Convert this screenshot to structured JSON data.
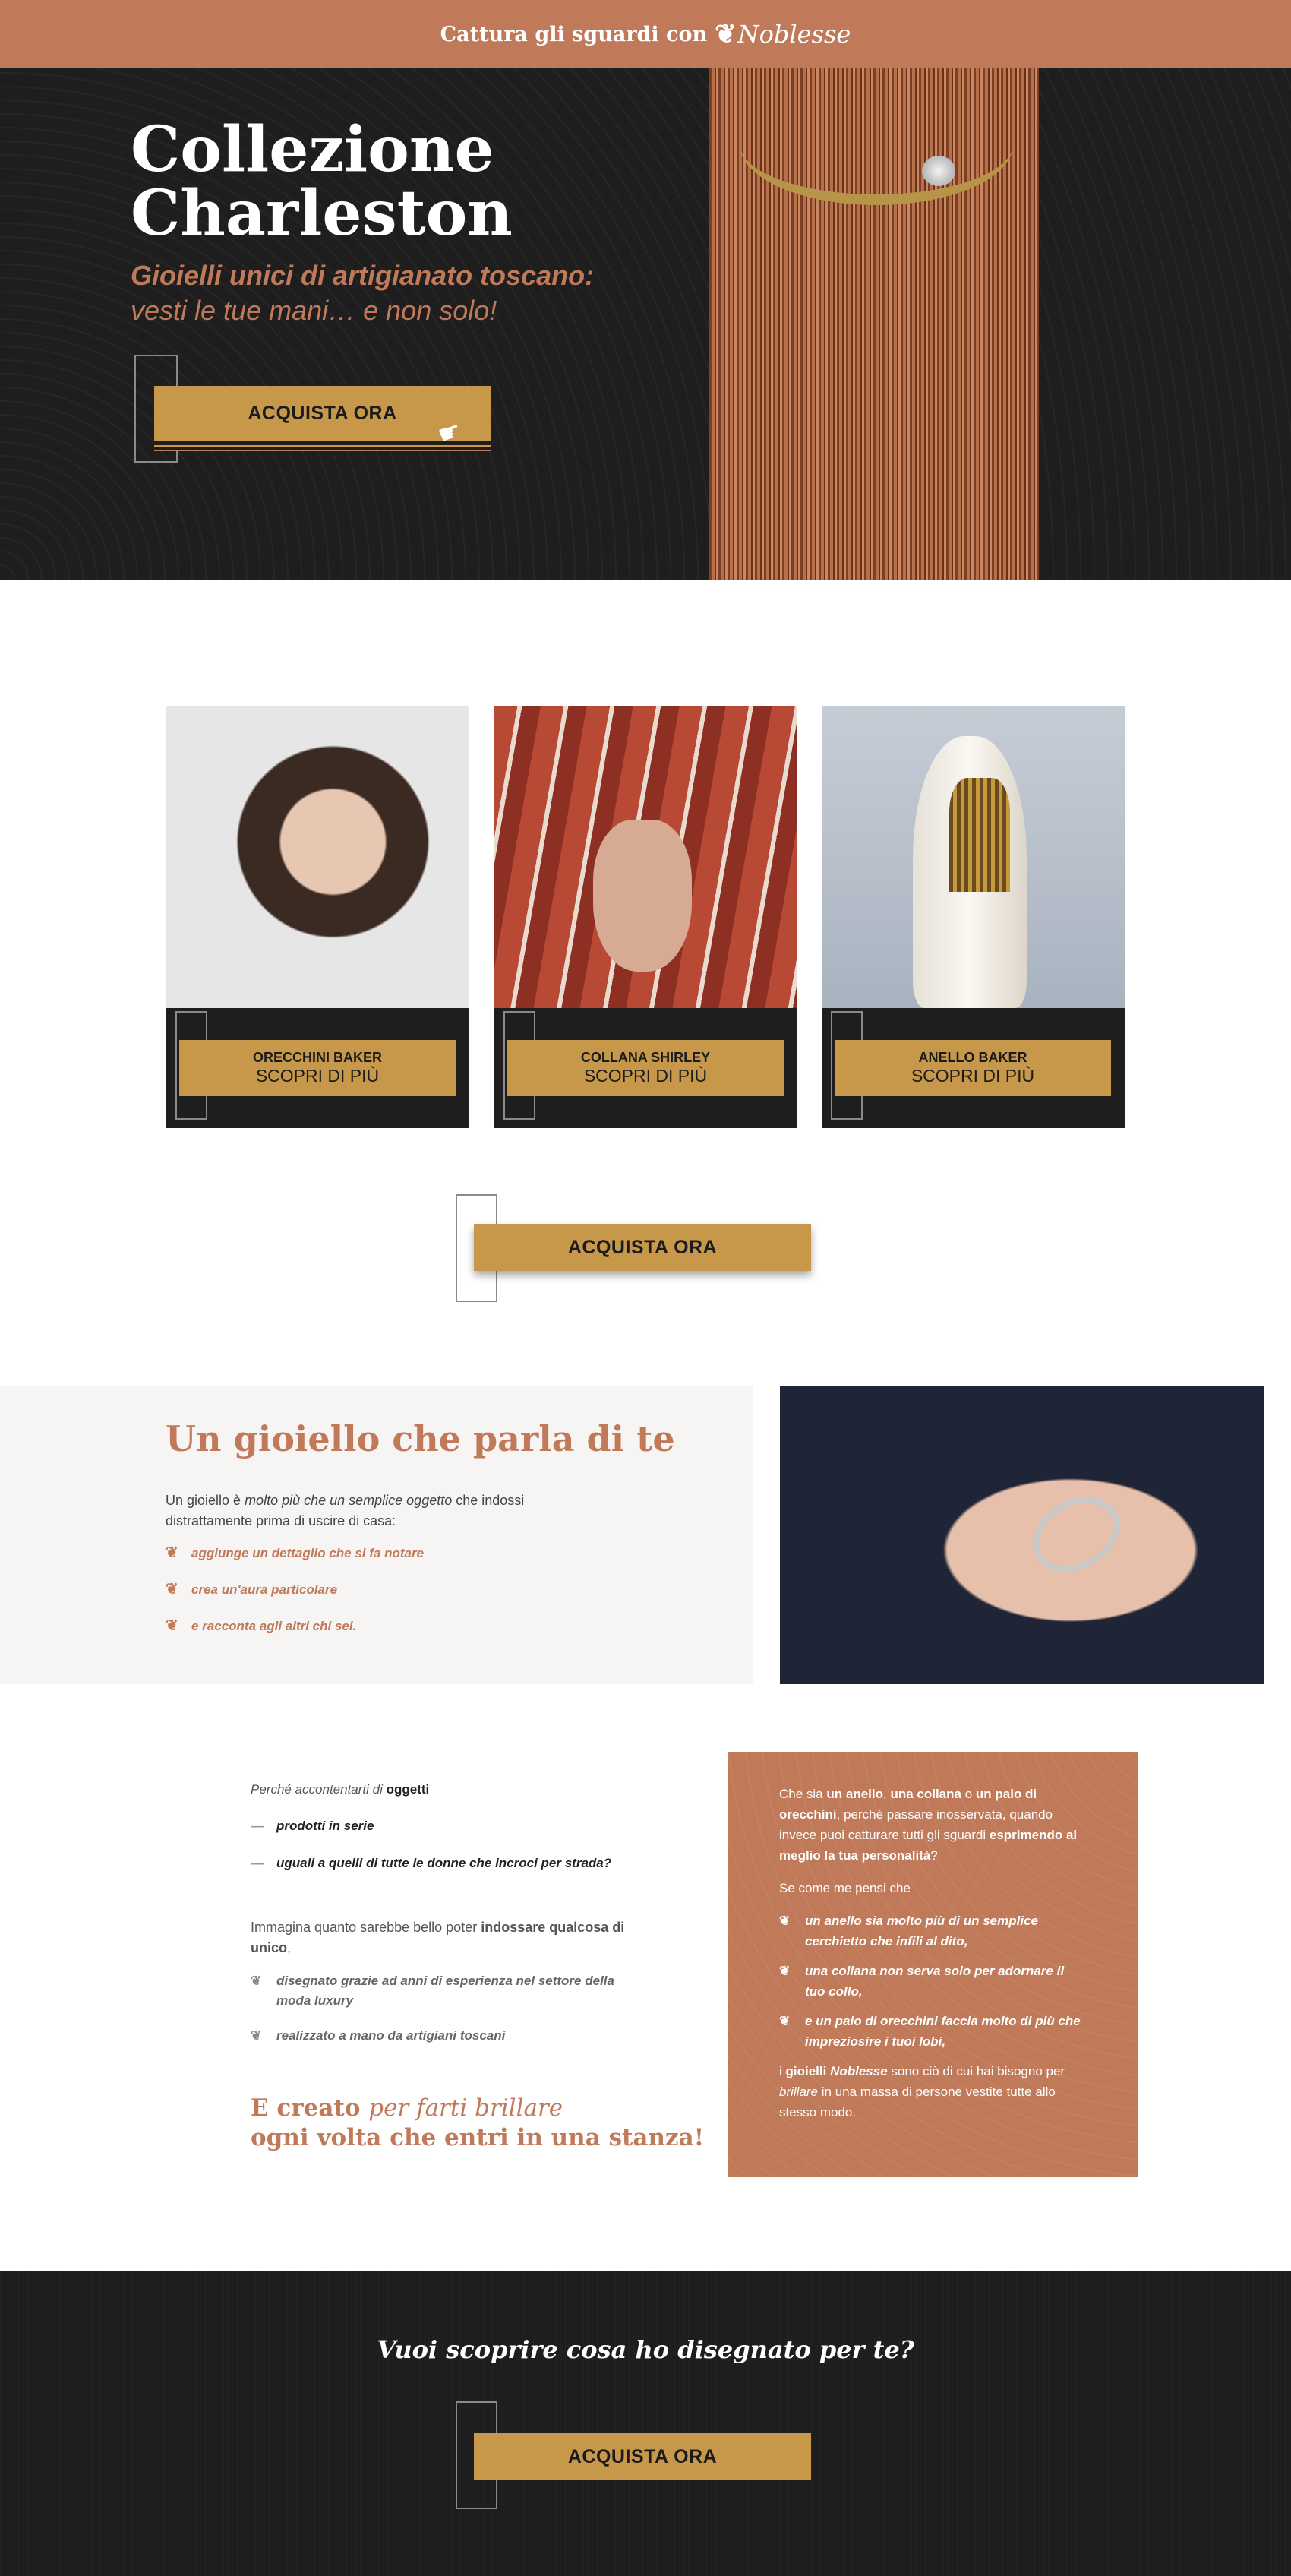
{
  "topbar": {
    "text": "Cattura gli sguardi con",
    "brand": "Noblesse",
    "brand_icon": "flower-icon"
  },
  "hero": {
    "title": "Collezione Charleston",
    "subtitle_bold": "Gioielli unici di artigianato toscano:",
    "subtitle_regular": "vesti le tue mani… e non solo!",
    "cta": "ACQUISTA ORA"
  },
  "products": [
    {
      "name": "ORECCHINI BAKER",
      "cta": "SCOPRI DI PIÙ"
    },
    {
      "name": "COLLANA SHIRLEY",
      "cta": "SCOPRI DI PIÙ"
    },
    {
      "name": "ANELLO BAKER",
      "cta": "SCOPRI DI PIÙ"
    }
  ],
  "middle_cta": "ACQUISTA ORA",
  "talk": {
    "title": "Un gioiello che parla di te",
    "intro_a": "Un gioiello è ",
    "intro_em": "molto più che un semplice oggetto",
    "intro_b": " che indossi distrattamente prima di uscire di casa:",
    "bullets": [
      "aggiunge un dettaglio che si fa notare",
      "crea un'aura particolare",
      "e racconta agli altri chi sei."
    ]
  },
  "why": {
    "lead": "Perché accontentarti di",
    "lead_bold": "oggetti",
    "items": [
      "prodotti in serie",
      "uguali a quelli di tutte le donne che incroci per strada?"
    ]
  },
  "imagine": {
    "text_a": "Immagina quanto sarebbe bello poter ",
    "text_bold": "indossare qualcosa di unico",
    "text_b": ",",
    "bullets": [
      "disegnato grazie ad anni di esperienza nel settore della moda luxury",
      "realizzato a mano da artigiani toscani"
    ]
  },
  "shine": {
    "line1_a": "E creato ",
    "line1_em": "per farti brillare",
    "line2": "ogni volta che entri in una stanza!"
  },
  "copper": {
    "p1_a": "Che sia ",
    "p1_b1": "un anello",
    "p1_c": ", ",
    "p1_b2": "una collana",
    "p1_d": " o ",
    "p1_b3": "un paio di orecchini",
    "p1_e": ", perché passare inosservata, quando invece puoi catturare tutti gli sguardi ",
    "p1_b4": "esprimendo al meglio la tua personalità",
    "p1_f": "?",
    "p2": "Se come me pensi che",
    "bullets": [
      "un anello sia molto più di un semplice cerchietto che infili al dito,",
      "una collana non serva solo per adornare il tuo collo,",
      "e un paio di orecchini faccia molto di più che impreziosire i tuoi lobi,"
    ],
    "p3_a": "i ",
    "p3_b": "gioielli ",
    "p3_bi": "Noblesse",
    "p3_c": " sono ciò di cui hai bisogno per ",
    "p3_i": "brillare",
    "p3_d": " in una massa di persone vestite tutte allo stesso modo."
  },
  "footer": {
    "question": "Vuoi scoprire cosa ho disegnato per te?",
    "cta": "ACQUISTA ORA"
  },
  "colors": {
    "copper": "#c07a5a",
    "gold": "#c7974a",
    "dark": "#1e1e1e"
  }
}
